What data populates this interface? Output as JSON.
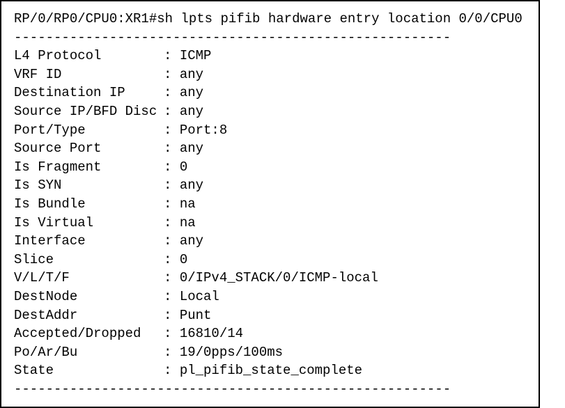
{
  "prompt": "RP/0/RP0/CPU0:XR1#",
  "command": "sh lpts pifib hardware entry location 0/0/CPU0",
  "separator": "-------------------------------------------------------",
  "fields": [
    {
      "label": "L4 Protocol       ",
      "value": "ICMP"
    },
    {
      "label": "VRF ID            ",
      "value": "any"
    },
    {
      "label": "Destination IP    ",
      "value": "any"
    },
    {
      "label": "Source IP/BFD Disc",
      "value": "any"
    },
    {
      "label": "Port/Type         ",
      "value": "Port:8"
    },
    {
      "label": "Source Port       ",
      "value": "any"
    },
    {
      "label": "Is Fragment       ",
      "value": "0"
    },
    {
      "label": "Is SYN            ",
      "value": "any"
    },
    {
      "label": "Is Bundle         ",
      "value": "na"
    },
    {
      "label": "Is Virtual        ",
      "value": "na"
    },
    {
      "label": "Interface         ",
      "value": "any"
    },
    {
      "label": "Slice             ",
      "value": "0"
    },
    {
      "label": "V/L/T/F           ",
      "value": "0/IPv4_STACK/0/ICMP-local"
    },
    {
      "label": "DestNode          ",
      "value": "Local"
    },
    {
      "label": "DestAddr          ",
      "value": "Punt"
    },
    {
      "label": "Accepted/Dropped  ",
      "value": "16810/14"
    },
    {
      "label": "Po/Ar/Bu          ",
      "value": "19/0pps/100ms"
    },
    {
      "label": "State             ",
      "value": "pl_pifib_state_complete"
    }
  ]
}
